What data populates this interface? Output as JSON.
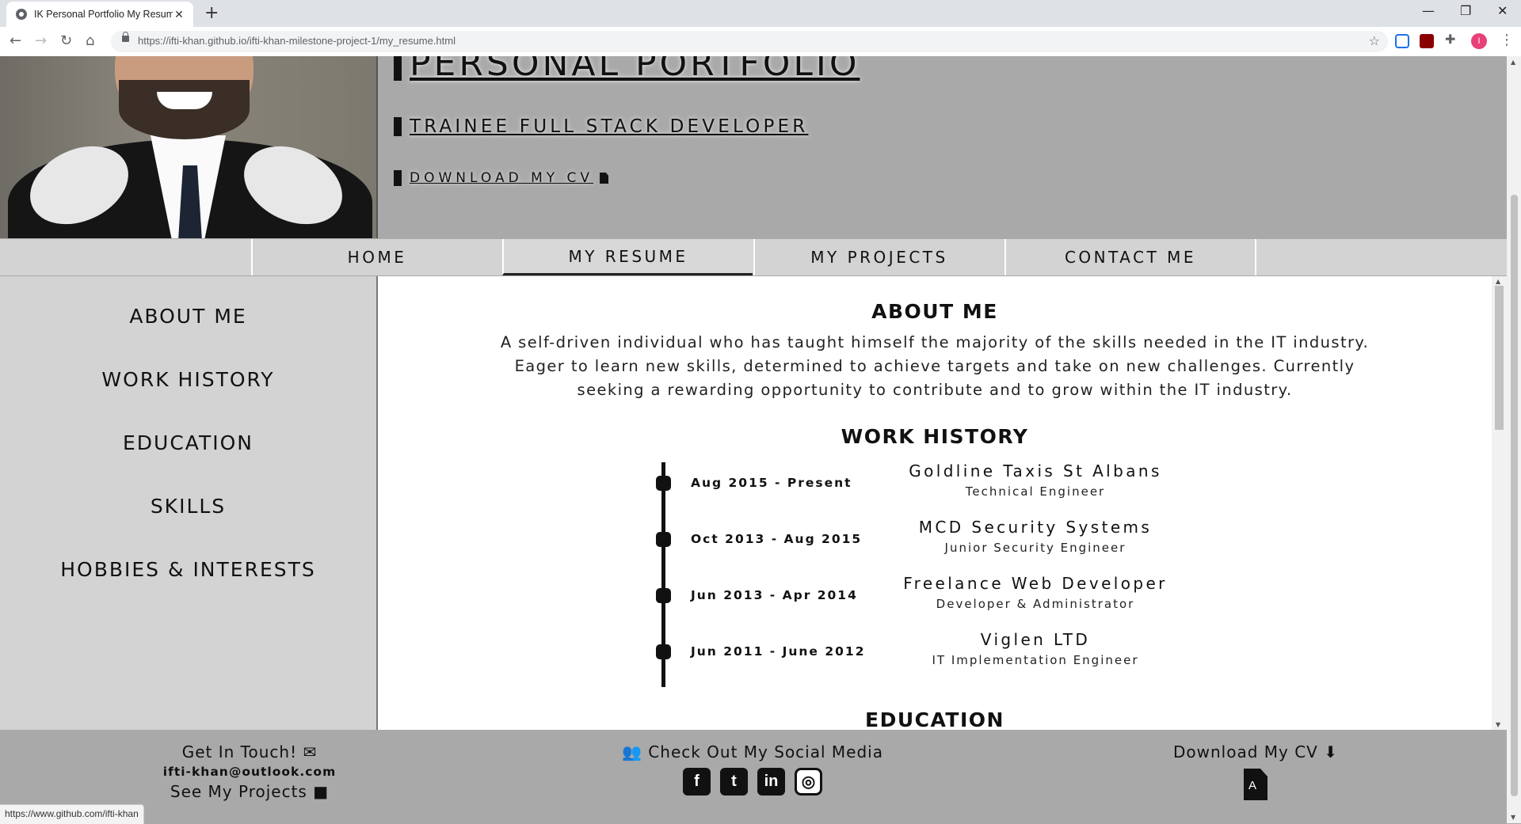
{
  "browser": {
    "tab_title": "IK Personal Portfolio My Resume",
    "tab_close": "✕",
    "new_tab": "+",
    "url": "https://ifti-khan.github.io/ifti-khan-milestone-project-1/my_resume.html",
    "profile_initial": "I",
    "status_url": "https://www.github.com/ifti-khan",
    "window_controls": [
      "—",
      "❐",
      "✕"
    ]
  },
  "hero": {
    "title": "PERSONAL PORTFOLIO",
    "subtitle": "TRAINEE FULL STACK DEVELOPER",
    "cv_link": "DOWNLOAD MY CV"
  },
  "nav": {
    "items": [
      {
        "label": "HOME"
      },
      {
        "label": "MY RESUME",
        "active": true
      },
      {
        "label": "MY PROJECTS"
      },
      {
        "label": "CONTACT ME"
      }
    ]
  },
  "sidebar": {
    "items": [
      {
        "label": "ABOUT ME"
      },
      {
        "label": "WORK HISTORY"
      },
      {
        "label": "EDUCATION"
      },
      {
        "label": "SKILLS"
      },
      {
        "label": "HOBBIES & INTERESTS"
      }
    ]
  },
  "about": {
    "heading": "ABOUT ME",
    "text": "A self-driven individual who has taught himself the majority of the skills needed in the IT industry. Eager to learn new skills, determined to achieve targets and take on new challenges. Currently seeking a rewarding opportunity to contribute and to grow within the IT industry."
  },
  "work": {
    "heading": "WORK HISTORY",
    "entries": [
      {
        "date": "Aug 2015 - Present",
        "company": "Goldline Taxis St Albans",
        "role": "Technical Engineer"
      },
      {
        "date": "Oct 2013 - Aug 2015",
        "company": "MCD Security Systems",
        "role": "Junior Security Engineer"
      },
      {
        "date": "Jun 2013 - Apr 2014",
        "company": "Freelance Web Developer",
        "role": "Developer & Administrator"
      },
      {
        "date": "Jun 2011 - June 2012",
        "company": "Viglen LTD",
        "role": "IT Implementation Engineer"
      }
    ]
  },
  "education": {
    "heading": "EDUCATION"
  },
  "footer": {
    "contact_title": "Get In Touch!",
    "email": "ifti-khan@outlook.com",
    "projects_link": "See My Projects",
    "social_title": "Check Out My Social Media",
    "social_icons": [
      "facebook-icon",
      "twitter-icon",
      "linkedin-icon",
      "github-icon"
    ],
    "cv_title": "Download My CV"
  },
  "colors": {
    "hero_bg": "#a9a9a9",
    "nav_bg": "#d3d3d3",
    "main_bg": "#ffffff",
    "text": "#111111"
  }
}
